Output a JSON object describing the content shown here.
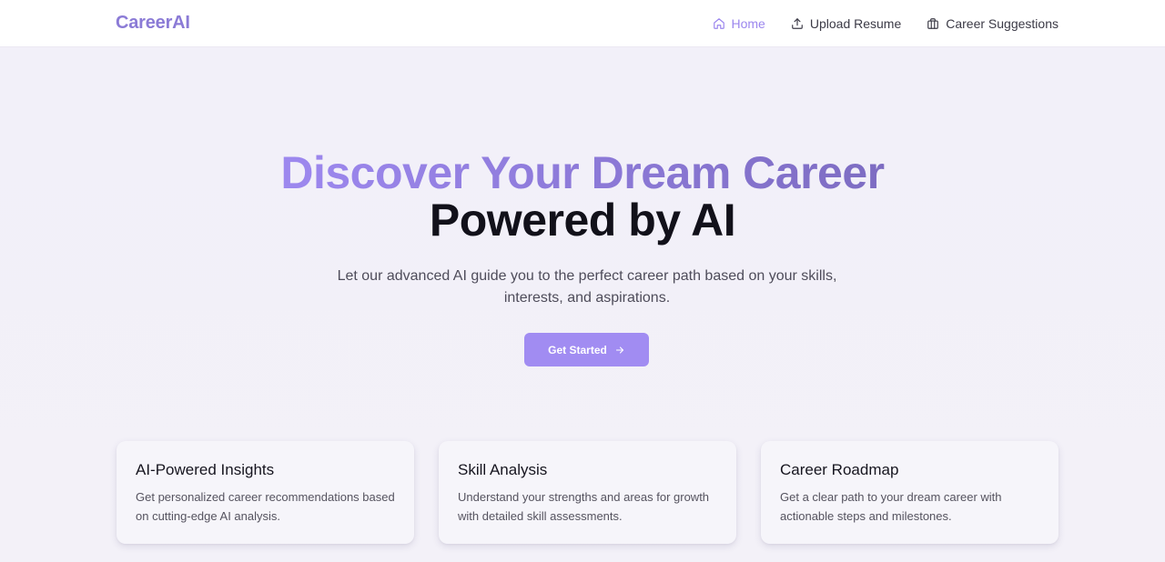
{
  "brand": "CareerAI",
  "nav": {
    "home": "Home",
    "upload": "Upload Resume",
    "suggestions": "Career Suggestions"
  },
  "hero": {
    "headline_line1": "Discover Your Dream Career",
    "headline_line2": "Powered by AI",
    "subtitle": "Let our advanced AI guide you to the perfect career path based on your skills, interests, and aspirations.",
    "cta": "Get Started"
  },
  "features": [
    {
      "title": "AI-Powered Insights",
      "description": "Get personalized career recommendations based on cutting-edge AI analysis."
    },
    {
      "title": "Skill Analysis",
      "description": "Understand your strengths and areas for growth with detailed skill assessments."
    },
    {
      "title": "Career Roadmap",
      "description": "Get a clear path to your dream career with actionable steps and milestones."
    }
  ],
  "icons": {
    "home": "home-icon",
    "upload": "upload-icon",
    "suggestions": "briefcase-icon",
    "cta": "arrow-right-icon"
  },
  "colors": {
    "accent": "#9b86ee",
    "brand": "#8b7bd6",
    "cta_background": "#a18cf2"
  }
}
